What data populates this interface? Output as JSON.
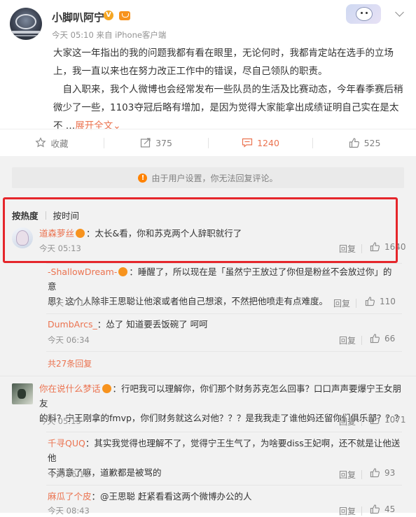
{
  "post": {
    "username": "小脚叭阿宁",
    "verified_badge": "V",
    "time": "今天 05:10",
    "source": "来自 iPhone客户端",
    "paragraph1": "大家这一年指出的我的问题我都有看在眼里，无论何时，我都肯定站在选手的立场上，我一直以来也在努力改正工作中的错误，尽自己领队的职责。",
    "paragraph2": "自入职来，我个人微博也会经常发布一些队员的生活及比赛动态，今年春季赛后稍微少了一些，1103夺冠后略有增加，是因为觉得大家能拿出成绩证明自己实在是太不 …",
    "expand_label": "展开全文",
    "expand_arrow": "⌄"
  },
  "actions": {
    "favorite": "收藏",
    "repost_count": "375",
    "comment_count": "1240",
    "like_count": "525",
    "active_color": "#eb7350"
  },
  "notice": {
    "icon": "!",
    "text": "由于用户设置，你无法回复评论。"
  },
  "sort": {
    "by_hot": "按热度",
    "by_time": "按时间"
  },
  "comments": [
    {
      "name": "道森萝丝",
      "text": "：太长&看，你和苏克两个人辞职就行了",
      "time": "今天 05:13",
      "reply": "回复",
      "likes": "1640"
    },
    {
      "name": "你在说什么梦话",
      "text_line1": "：行吧我可以理解你，你们那个财务苏克怎么回事？口口声声要爆宁王女朋友",
      "text_line2": "的料？宁王刚拿的fmvp，你们财务就这么对他？？？是我我走了谁他妈还留你们俱乐部？？？",
      "time": "今天 05:15",
      "reply": "回复",
      "likes": "1071"
    }
  ],
  "replies_a": [
    {
      "name": "-ShallowDream-",
      "text_line1": "：睡醒了，所以现在是「虽然宁王放过了你但是粉丝不会放过你」的意",
      "text_line2": "思？这个人除非王思聪让他滚或者他自己想滚，不然把他喷走有点难度。",
      "time": "今天 07:17",
      "reply": "回复",
      "likes": "110"
    },
    {
      "name": "DumbArcs_",
      "text": "：怂了 知道要丢饭碗了 呵呵",
      "time": "今天 06:34",
      "reply": "回复",
      "likes": "66"
    }
  ],
  "more_replies": "共27条回复",
  "replies_b": [
    {
      "name": "千寻QUQ",
      "text_line1": "：其实我觉得也理解不了，觉得宁王生气了，为啥要diss王妃啊，还不就是让他送他",
      "text_line2": "不满意了嘛，道歉都是被骂的",
      "time": "今天 06:11",
      "reply": "回复",
      "likes": "93"
    },
    {
      "name": "麻瓜了个皮",
      "text": "：@王思聪 赶紧看看这两个微博办公的人",
      "time": "今天 08:43",
      "reply": "回复",
      "likes": "45"
    }
  ]
}
